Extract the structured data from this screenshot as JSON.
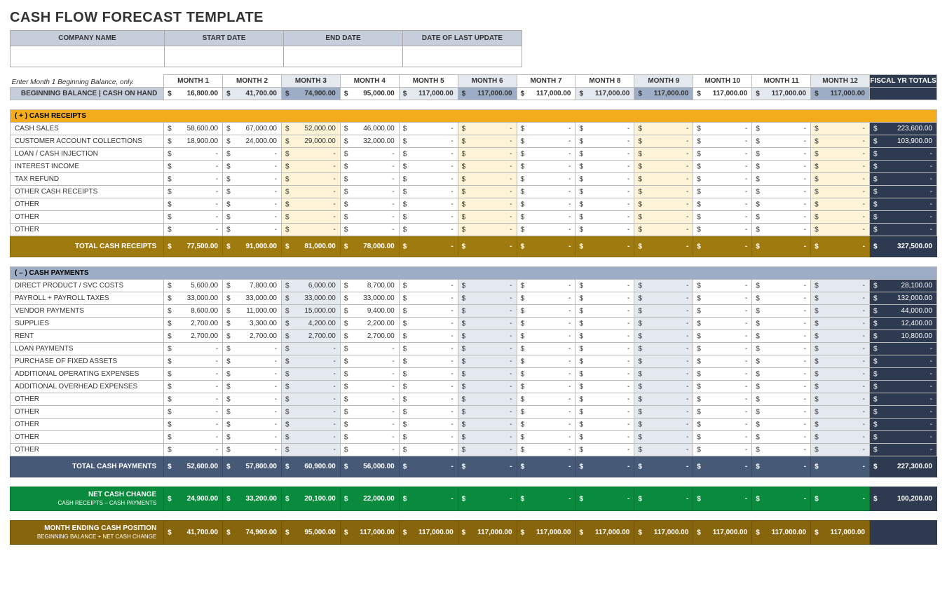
{
  "title": "CASH FLOW FORECAST TEMPLATE",
  "meta": {
    "headers": [
      "COMPANY NAME",
      "START DATE",
      "END DATE",
      "DATE OF LAST UPDATE"
    ],
    "values": [
      "",
      "",
      "",
      ""
    ]
  },
  "instruction": "Enter Month 1 Beginning Balance, only.",
  "month_labels": [
    "MONTH 1",
    "MONTH 2",
    "MONTH 3",
    "MONTH 4",
    "MONTH 5",
    "MONTH 6",
    "MONTH 7",
    "MONTH 8",
    "MONTH 9",
    "MONTH 10",
    "MONTH 11",
    "MONTH 12"
  ],
  "fiscal_header": "FISCAL YR TOTALS",
  "header_alt_cols": [
    2,
    5,
    8,
    11
  ],
  "beginning_balance": {
    "label": "BEGINNING BALANCE  |  CASH ON HAND",
    "values": [
      16800,
      41700,
      74900,
      95000,
      117000,
      117000,
      117000,
      117000,
      117000,
      117000,
      117000,
      117000
    ],
    "shade1_cols": [
      1,
      4,
      7,
      10
    ],
    "shade2_cols": [
      2,
      5,
      8,
      11
    ],
    "total": null
  },
  "receipts": {
    "section_label": "( + )   CASH RECEIPTS",
    "tint_cols": [
      2,
      5,
      8,
      11
    ],
    "rows": [
      {
        "label": "CASH SALES",
        "values": [
          58600,
          67000,
          52000,
          46000,
          null,
          null,
          null,
          null,
          null,
          null,
          null,
          null
        ],
        "total": 223600
      },
      {
        "label": "CUSTOMER ACCOUNT COLLECTIONS",
        "values": [
          18900,
          24000,
          29000,
          32000,
          null,
          null,
          null,
          null,
          null,
          null,
          null,
          null
        ],
        "total": 103900
      },
      {
        "label": "LOAN / CASH INJECTION",
        "values": [
          null,
          null,
          null,
          null,
          null,
          null,
          null,
          null,
          null,
          null,
          null,
          null
        ],
        "total": null
      },
      {
        "label": "INTEREST INCOME",
        "values": [
          null,
          null,
          null,
          null,
          null,
          null,
          null,
          null,
          null,
          null,
          null,
          null
        ],
        "total": null
      },
      {
        "label": "TAX REFUND",
        "values": [
          null,
          null,
          null,
          null,
          null,
          null,
          null,
          null,
          null,
          null,
          null,
          null
        ],
        "total": null
      },
      {
        "label": "OTHER CASH RECEIPTS",
        "values": [
          null,
          null,
          null,
          null,
          null,
          null,
          null,
          null,
          null,
          null,
          null,
          null
        ],
        "total": null
      },
      {
        "label": "OTHER",
        "values": [
          null,
          null,
          null,
          null,
          null,
          null,
          null,
          null,
          null,
          null,
          null,
          null
        ],
        "total": null
      },
      {
        "label": "OTHER",
        "values": [
          null,
          null,
          null,
          null,
          null,
          null,
          null,
          null,
          null,
          null,
          null,
          null
        ],
        "total": null
      },
      {
        "label": "OTHER",
        "values": [
          null,
          null,
          null,
          null,
          null,
          null,
          null,
          null,
          null,
          null,
          null,
          null
        ],
        "total": null
      }
    ],
    "totals_label": "TOTAL CASH RECEIPTS",
    "totals": [
      77500,
      91000,
      81000,
      78000,
      null,
      null,
      null,
      null,
      null,
      null,
      null,
      null
    ],
    "grand_total": 327500
  },
  "payments": {
    "section_label": "( – )   CASH PAYMENTS",
    "tint_cols": [
      2,
      5,
      8,
      11
    ],
    "rows": [
      {
        "label": "DIRECT PRODUCT / SVC COSTS",
        "values": [
          5600,
          7800,
          6000,
          8700,
          null,
          null,
          null,
          null,
          null,
          null,
          null,
          null
        ],
        "total": 28100
      },
      {
        "label": "PAYROLL + PAYROLL TAXES",
        "values": [
          33000,
          33000,
          33000,
          33000,
          null,
          null,
          null,
          null,
          null,
          null,
          null,
          null
        ],
        "total": 132000
      },
      {
        "label": "VENDOR PAYMENTS",
        "values": [
          8600,
          11000,
          15000,
          9400,
          null,
          null,
          null,
          null,
          null,
          null,
          null,
          null
        ],
        "total": 44000
      },
      {
        "label": "SUPPLIES",
        "values": [
          2700,
          3300,
          4200,
          2200,
          null,
          null,
          null,
          null,
          null,
          null,
          null,
          null
        ],
        "total": 12400
      },
      {
        "label": "RENT",
        "values": [
          2700,
          2700,
          2700,
          2700,
          null,
          null,
          null,
          null,
          null,
          null,
          null,
          null
        ],
        "total": 10800
      },
      {
        "label": "LOAN PAYMENTS",
        "values": [
          null,
          null,
          null,
          null,
          null,
          null,
          null,
          null,
          null,
          null,
          null,
          null
        ],
        "total": null
      },
      {
        "label": "PURCHASE OF FIXED ASSETS",
        "values": [
          null,
          null,
          null,
          null,
          null,
          null,
          null,
          null,
          null,
          null,
          null,
          null
        ],
        "total": null
      },
      {
        "label": "ADDITIONAL OPERATING EXPENSES",
        "values": [
          null,
          null,
          null,
          null,
          null,
          null,
          null,
          null,
          null,
          null,
          null,
          null
        ],
        "total": null
      },
      {
        "label": "ADDITIONAL OVERHEAD EXPENSES",
        "values": [
          null,
          null,
          null,
          null,
          null,
          null,
          null,
          null,
          null,
          null,
          null,
          null
        ],
        "total": null
      },
      {
        "label": "OTHER",
        "values": [
          null,
          null,
          null,
          null,
          null,
          null,
          null,
          null,
          null,
          null,
          null,
          null
        ],
        "total": null
      },
      {
        "label": "OTHER",
        "values": [
          null,
          null,
          null,
          null,
          null,
          null,
          null,
          null,
          null,
          null,
          null,
          null
        ],
        "total": null
      },
      {
        "label": "OTHER",
        "values": [
          null,
          null,
          null,
          null,
          null,
          null,
          null,
          null,
          null,
          null,
          null,
          null
        ],
        "total": null
      },
      {
        "label": "OTHER",
        "values": [
          null,
          null,
          null,
          null,
          null,
          null,
          null,
          null,
          null,
          null,
          null,
          null
        ],
        "total": null
      },
      {
        "label": "OTHER",
        "values": [
          null,
          null,
          null,
          null,
          null,
          null,
          null,
          null,
          null,
          null,
          null,
          null
        ],
        "total": null
      }
    ],
    "totals_label": "TOTAL CASH PAYMENTS",
    "totals": [
      52600,
      57800,
      60900,
      56000,
      null,
      null,
      null,
      null,
      null,
      null,
      null,
      null
    ],
    "grand_total": 227300
  },
  "net_change": {
    "label": "NET CASH CHANGE",
    "sub": "CASH RECEIPTS – CASH PAYMENTS",
    "values": [
      24900,
      33200,
      20100,
      22000,
      null,
      null,
      null,
      null,
      null,
      null,
      null,
      null
    ],
    "total": 100200
  },
  "ending_position": {
    "label": "MONTH ENDING CASH POSITION",
    "sub": "BEGINNING BALANCE + NET CASH CHANGE",
    "values": [
      41700,
      74900,
      95000,
      117000,
      117000,
      117000,
      117000,
      117000,
      117000,
      117000,
      117000,
      117000
    ],
    "total": null
  }
}
